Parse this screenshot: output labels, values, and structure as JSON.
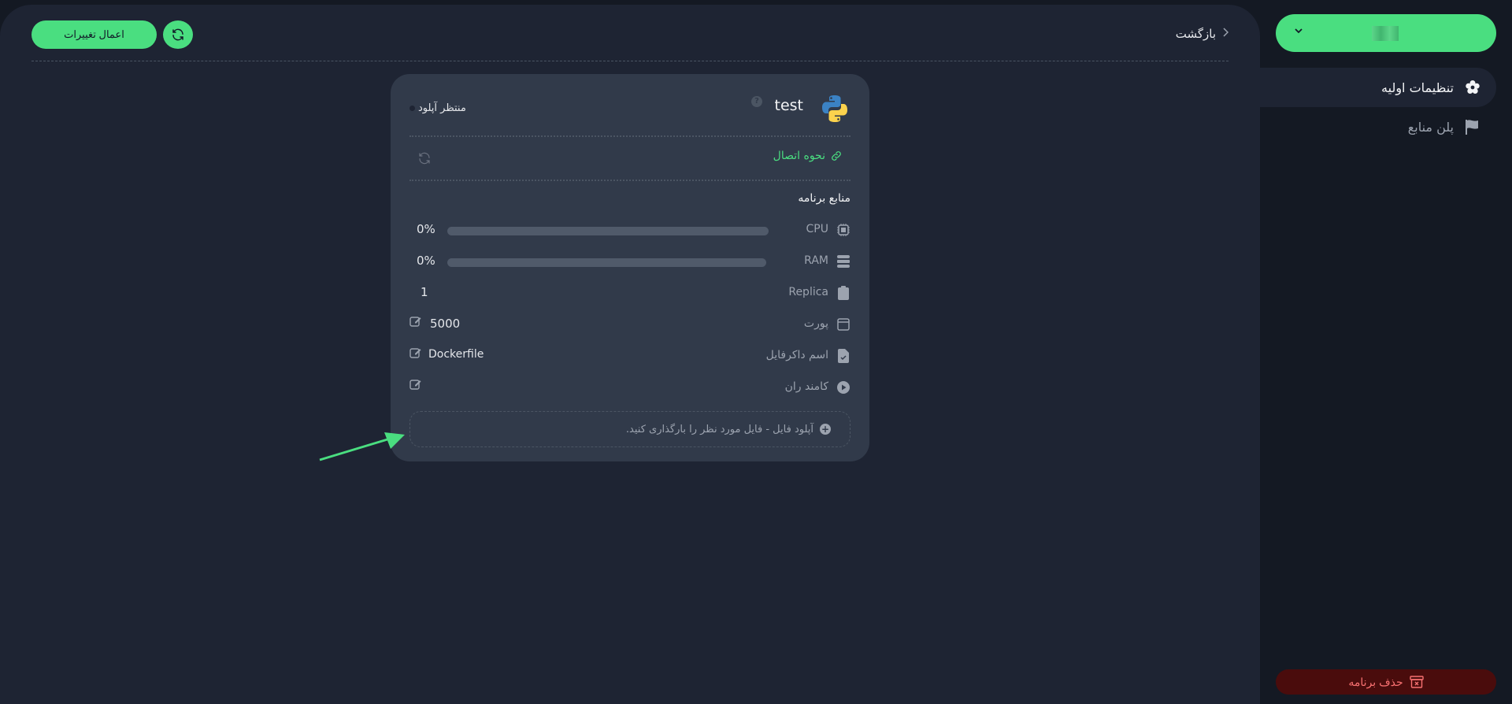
{
  "toolbar": {
    "apply_label": "اعمال تغییرات",
    "refresh_icon": "refresh-icon",
    "back_label": "بازگشت"
  },
  "card": {
    "app_name": "test",
    "runtime_icon": "python-logo",
    "status": "منتظر آپلود",
    "connect_label": "نحوه اتصال",
    "resources_title": "منابع برنامه",
    "cpu": {
      "label": "CPU",
      "value": "0%",
      "progress": 0
    },
    "ram": {
      "label": "RAM",
      "value": "0%",
      "progress": 0
    },
    "replica": {
      "label": "Replica",
      "value": "1"
    },
    "port": {
      "label": "پورت",
      "value": "5000"
    },
    "dockerfile": {
      "label": "اسم داکرفایل",
      "value": "Dockerfile"
    },
    "run_command": {
      "label": "کامند ران",
      "value": ""
    },
    "upload_text": "آپلود فایل - فایل مورد نظر را بارگذاری کنید."
  },
  "sidebar": {
    "app_selector_value": "",
    "items": [
      {
        "label": "تنظیمات اولیه",
        "icon": "gear-icon",
        "active": true
      },
      {
        "label": "پلن منابع",
        "icon": "flag-icon",
        "active": false
      }
    ],
    "delete_label": "حذف برنامه"
  },
  "colors": {
    "accent": "#4ade80",
    "danger_bg": "#4a0c0c",
    "danger_text": "#f87171",
    "panel": "#1e2433",
    "card": "#313a4a"
  }
}
